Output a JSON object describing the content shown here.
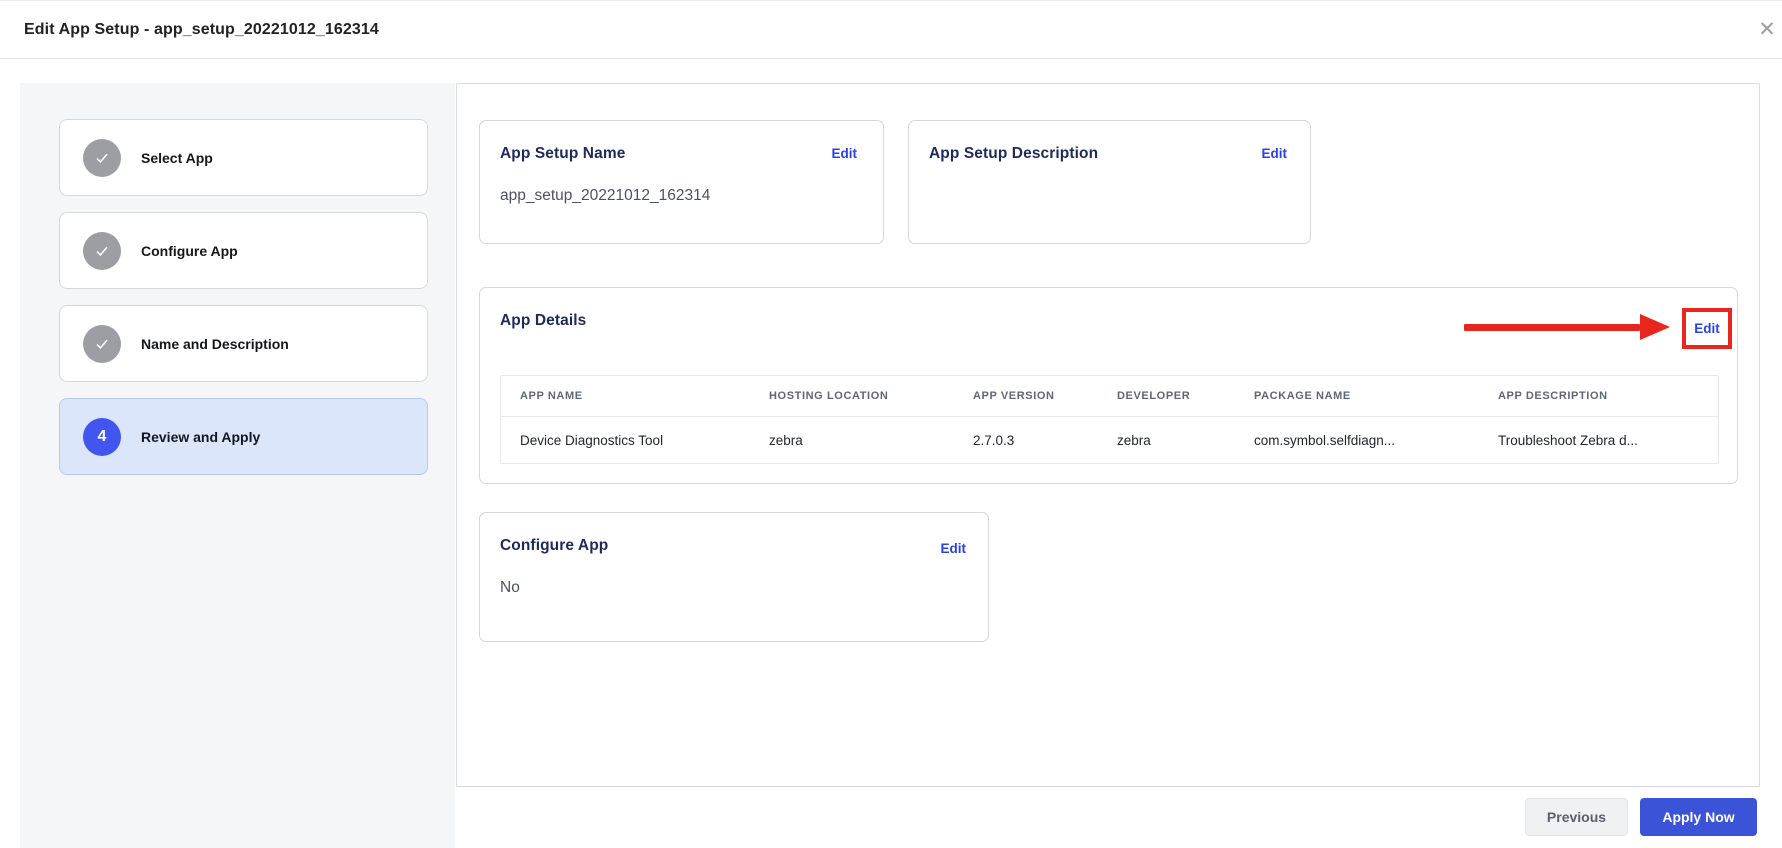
{
  "header": {
    "title": "Edit App Setup - app_setup_20221012_162314"
  },
  "icons": {
    "close": "✕"
  },
  "sidebar": {
    "steps": [
      {
        "label": "Select App",
        "state": "completed"
      },
      {
        "label": "Configure App",
        "state": "completed"
      },
      {
        "label": "Name and Description",
        "state": "completed"
      },
      {
        "label": "Review and Apply",
        "state": "active",
        "number": "4"
      }
    ]
  },
  "cards": {
    "app_setup_name": {
      "title": "App Setup Name",
      "edit_label": "Edit",
      "value": "app_setup_20221012_162314"
    },
    "app_setup_description": {
      "title": "App Setup Description",
      "edit_label": "Edit"
    },
    "app_details": {
      "title": "App Details",
      "edit_label": "Edit",
      "table": {
        "headers": [
          "APP NAME",
          "HOSTING LOCATION",
          "APP VERSION",
          "DEVELOPER",
          "PACKAGE NAME",
          "APP DESCRIPTION"
        ],
        "row": [
          "Device Diagnostics Tool",
          "zebra",
          "2.7.0.3",
          "zebra",
          "com.symbol.selfdiagn...",
          "Troubleshoot Zebra d..."
        ]
      }
    },
    "configure_app": {
      "title": "Configure App",
      "edit_label": "Edit",
      "value": "No"
    }
  },
  "footer": {
    "previous_label": "Previous",
    "apply_label": "Apply Now"
  },
  "colors": {
    "link_blue": "#2742e8",
    "apply_button_blue": "#3b54d7",
    "active_step_blue": "#4355ef",
    "active_step_bg": "#dbe6fb",
    "completed_step_gray": "#9c9ea3",
    "annotation_red": "#e8261d",
    "card_title_navy": "#1d2a5a",
    "sidebar_bg": "#f5f6f8"
  }
}
